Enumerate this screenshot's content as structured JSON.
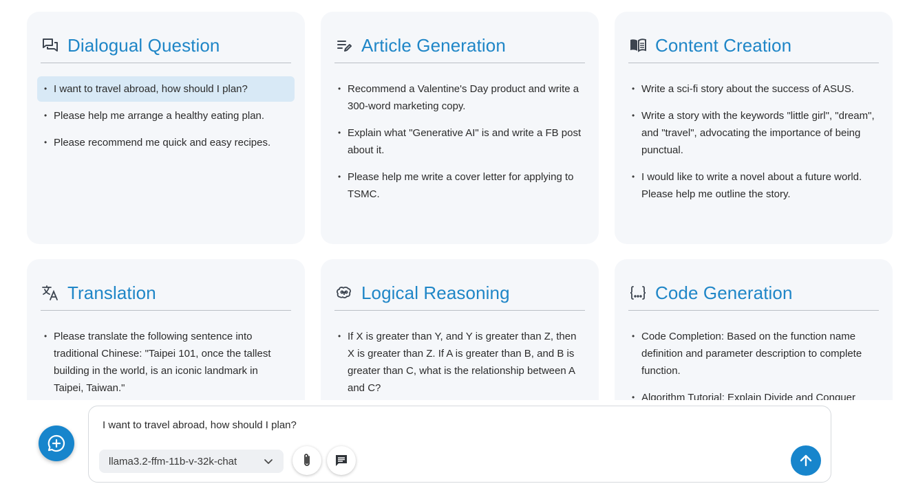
{
  "cards": [
    {
      "title": "Dialogual Question",
      "icon": "chat-bubbles-icon",
      "items": [
        "I want to travel abroad, how should I plan?",
        "Please help me arrange a healthy eating plan.",
        "Please recommend me quick and easy recipes."
      ]
    },
    {
      "title": "Article Generation",
      "icon": "edit-notes-icon",
      "items": [
        "Recommend a Valentine's Day product and write a 300-word marketing copy.",
        "Explain what \"Generative AI\" is and write a FB post about it.",
        "Please help me write a cover letter for applying to TSMC."
      ]
    },
    {
      "title": "Content Creation",
      "icon": "open-book-icon",
      "items": [
        "Write a sci-fi story about the success of ASUS.",
        "Write a story with the keywords \"little girl\", \"dream\", and \"travel\", advocating the importance of being punctual.",
        "I would like to write a novel about a future world. Please help me outline the story."
      ]
    },
    {
      "title": "Translation",
      "icon": "translate-icon",
      "items": [
        "Please translate the following sentence into traditional Chinese: \"Taipei 101, once the tallest building in the world, is an iconic landmark in Taipei, Taiwan.\""
      ]
    },
    {
      "title": "Logical Reasoning",
      "icon": "brain-icon",
      "items": [
        "If X is greater than Y, and Y is greater than Z, then X is greater than Z. If A is greater than B, and B is greater than C, what is the relationship between A and C?"
      ]
    },
    {
      "title": "Code Generation",
      "icon": "code-braces-icon",
      "items": [
        "Code Completion: Based on the function name definition and parameter description to complete function.",
        "Algorithm Tutorial: Explain Divide and Conquer"
      ]
    }
  ],
  "composer": {
    "input_value": "I want to travel abroad, how should I plan?",
    "model": "llama3.2-ffm-11b-v-32k-chat"
  },
  "colors": {
    "accent": "#1785cc",
    "title": "#1f86c7",
    "card_bg": "#f5f7fa",
    "active_item_bg": "#d8e9f6"
  }
}
